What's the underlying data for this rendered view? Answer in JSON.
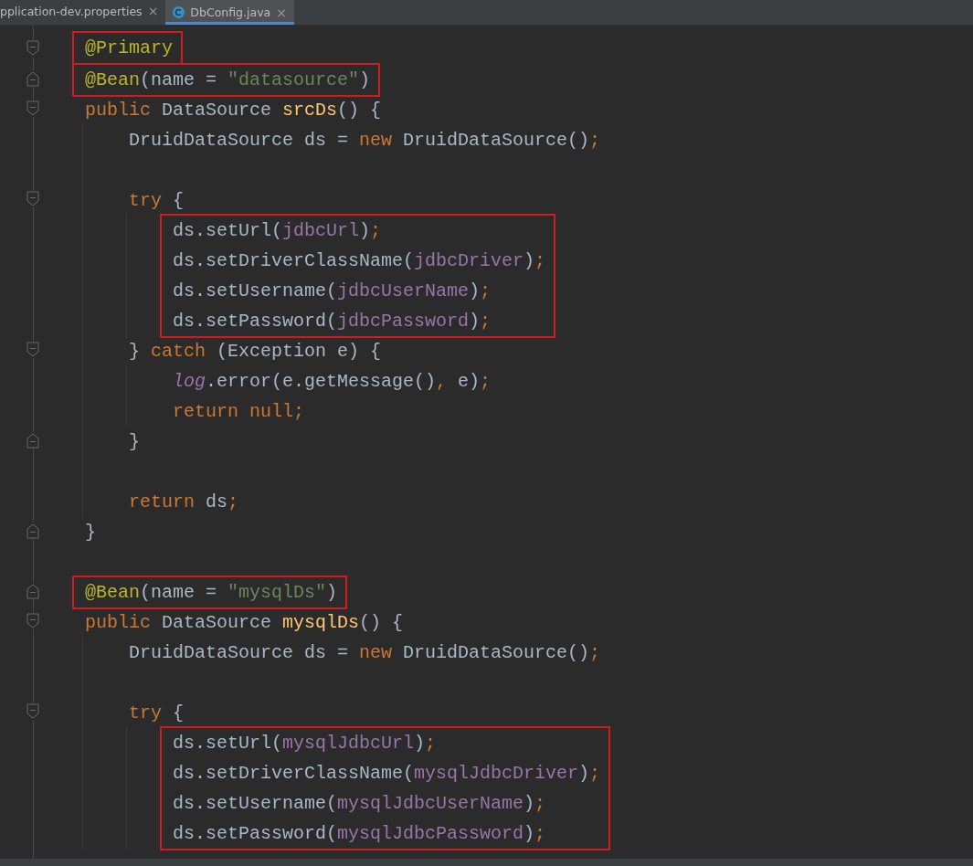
{
  "tabs": [
    {
      "label": "pplication-dev.properties",
      "close": "×",
      "kind": "properties",
      "selected": false
    },
    {
      "label": "DbConfig.java",
      "close": "×",
      "kind": "class",
      "selected": true
    }
  ],
  "code": [
    {
      "kind": "box",
      "children": [
        {
          "kind": "line",
          "fold_start": true,
          "tokens": [
            {
              "kind": "ann",
              "text": "@Primary"
            }
          ]
        }
      ]
    },
    {
      "kind": "box",
      "children": [
        {
          "kind": "line",
          "fold_end": true,
          "tokens": [
            {
              "kind": "ann",
              "text": "@Bean"
            },
            {
              "kind": "plain",
              "text": "(name = "
            },
            {
              "kind": "str",
              "text": "\"datasource\""
            },
            {
              "kind": "plain",
              "text": ")"
            }
          ]
        }
      ]
    },
    {
      "kind": "line",
      "fold_start": true,
      "tokens": [
        {
          "kind": "kw",
          "text": "public "
        },
        {
          "kind": "plain",
          "text": "DataSource "
        },
        {
          "kind": "decl",
          "text": "srcDs"
        },
        {
          "kind": "plain",
          "text": "() {"
        }
      ]
    },
    {
      "kind": "block",
      "children": [
        {
          "kind": "line",
          "tokens": [
            {
              "kind": "plain",
              "text": "DruidDataSource ds = "
            },
            {
              "kind": "kw",
              "text": "new "
            },
            {
              "kind": "plain",
              "text": "DruidDataSource()"
            },
            {
              "kind": "kw",
              "text": ";"
            }
          ]
        },
        {
          "kind": "blank"
        },
        {
          "kind": "line",
          "fold_start": true,
          "tokens": [
            {
              "kind": "kw",
              "text": "try "
            },
            {
              "kind": "plain",
              "text": "{"
            }
          ]
        },
        {
          "kind": "block",
          "children": [
            {
              "kind": "box",
              "children": [
                {
                  "kind": "line",
                  "tokens": [
                    {
                      "kind": "plain",
                      "text": "ds.setUrl("
                    },
                    {
                      "kind": "field",
                      "text": "jdbcUrl"
                    },
                    {
                      "kind": "plain",
                      "text": ")"
                    },
                    {
                      "kind": "kw",
                      "text": ";"
                    }
                  ]
                },
                {
                  "kind": "line",
                  "tokens": [
                    {
                      "kind": "plain",
                      "text": "ds.setDriverClassName("
                    },
                    {
                      "kind": "field",
                      "text": "jdbcDriver"
                    },
                    {
                      "kind": "plain",
                      "text": ")"
                    },
                    {
                      "kind": "kw",
                      "text": ";"
                    }
                  ]
                },
                {
                  "kind": "line",
                  "tokens": [
                    {
                      "kind": "plain",
                      "text": "ds.setUsername("
                    },
                    {
                      "kind": "field",
                      "text": "jdbcUserName"
                    },
                    {
                      "kind": "plain",
                      "text": ")"
                    },
                    {
                      "kind": "kw",
                      "text": ";"
                    }
                  ]
                },
                {
                  "kind": "line",
                  "tokens": [
                    {
                      "kind": "plain",
                      "text": "ds.setPassword("
                    },
                    {
                      "kind": "field",
                      "text": "jdbcPassword"
                    },
                    {
                      "kind": "plain",
                      "text": ")"
                    },
                    {
                      "kind": "kw",
                      "text": ";"
                    }
                  ]
                }
              ]
            }
          ]
        },
        {
          "kind": "line",
          "fold_start": true,
          "tokens": [
            {
              "kind": "plain",
              "text": "} "
            },
            {
              "kind": "kw",
              "text": "catch "
            },
            {
              "kind": "plain",
              "text": "(Exception e) {"
            }
          ]
        },
        {
          "kind": "block",
          "children": [
            {
              "kind": "line",
              "tokens": [
                {
                  "kind": "static",
                  "text": "log"
                },
                {
                  "kind": "plain",
                  "text": ".error(e.getMessage()"
                },
                {
                  "kind": "kw",
                  "text": ", "
                },
                {
                  "kind": "plain",
                  "text": "e)"
                },
                {
                  "kind": "kw",
                  "text": ";"
                }
              ]
            },
            {
              "kind": "line",
              "tokens": [
                {
                  "kind": "kw",
                  "text": "return null;"
                }
              ]
            }
          ]
        },
        {
          "kind": "line",
          "fold_end": true,
          "tokens": [
            {
              "kind": "plain",
              "text": "}"
            }
          ]
        },
        {
          "kind": "blank"
        },
        {
          "kind": "line",
          "tokens": [
            {
              "kind": "kw",
              "text": "return "
            },
            {
              "kind": "plain",
              "text": "ds"
            },
            {
              "kind": "kw",
              "text": ";"
            }
          ]
        }
      ]
    },
    {
      "kind": "line",
      "fold_end": true,
      "tokens": [
        {
          "kind": "plain",
          "text": "}"
        }
      ]
    },
    {
      "kind": "blank"
    },
    {
      "kind": "box",
      "children": [
        {
          "kind": "line",
          "fold_end": true,
          "tokens": [
            {
              "kind": "ann",
              "text": "@Bean"
            },
            {
              "kind": "plain",
              "text": "(name = "
            },
            {
              "kind": "str",
              "text": "\"mysqlDs\""
            },
            {
              "kind": "plain",
              "text": ")"
            }
          ]
        }
      ]
    },
    {
      "kind": "line",
      "fold_start": true,
      "tokens": [
        {
          "kind": "kw",
          "text": "public "
        },
        {
          "kind": "plain",
          "text": "DataSource "
        },
        {
          "kind": "decl",
          "text": "mysqlDs"
        },
        {
          "kind": "plain",
          "text": "() {"
        }
      ]
    },
    {
      "kind": "block",
      "children": [
        {
          "kind": "line",
          "tokens": [
            {
              "kind": "plain",
              "text": "DruidDataSource ds = "
            },
            {
              "kind": "kw",
              "text": "new "
            },
            {
              "kind": "plain",
              "text": "DruidDataSource()"
            },
            {
              "kind": "kw",
              "text": ";"
            }
          ]
        },
        {
          "kind": "blank"
        },
        {
          "kind": "line",
          "fold_start": true,
          "tokens": [
            {
              "kind": "kw",
              "text": "try "
            },
            {
              "kind": "plain",
              "text": "{"
            }
          ]
        },
        {
          "kind": "block",
          "children": [
            {
              "kind": "box",
              "children": [
                {
                  "kind": "line",
                  "tokens": [
                    {
                      "kind": "plain",
                      "text": "ds.setUrl("
                    },
                    {
                      "kind": "field",
                      "text": "mysqlJdbcUrl"
                    },
                    {
                      "kind": "plain",
                      "text": ")"
                    },
                    {
                      "kind": "kw",
                      "text": ";"
                    }
                  ]
                },
                {
                  "kind": "line",
                  "tokens": [
                    {
                      "kind": "plain",
                      "text": "ds.setDriverClassName("
                    },
                    {
                      "kind": "field",
                      "text": "mysqlJdbcDriver"
                    },
                    {
                      "kind": "plain",
                      "text": ")"
                    },
                    {
                      "kind": "kw",
                      "text": ";"
                    }
                  ]
                },
                {
                  "kind": "line",
                  "tokens": [
                    {
                      "kind": "plain",
                      "text": "ds.setUsername("
                    },
                    {
                      "kind": "field",
                      "text": "mysqlJdbcUserName"
                    },
                    {
                      "kind": "plain",
                      "text": ")"
                    },
                    {
                      "kind": "kw",
                      "text": ";"
                    }
                  ]
                },
                {
                  "kind": "line",
                  "tokens": [
                    {
                      "kind": "plain",
                      "text": "ds.setPassword("
                    },
                    {
                      "kind": "field",
                      "text": "mysqlJdbcPassword"
                    },
                    {
                      "kind": "plain",
                      "text": ")"
                    },
                    {
                      "kind": "kw",
                      "text": ";"
                    }
                  ]
                }
              ]
            }
          ]
        }
      ]
    }
  ]
}
